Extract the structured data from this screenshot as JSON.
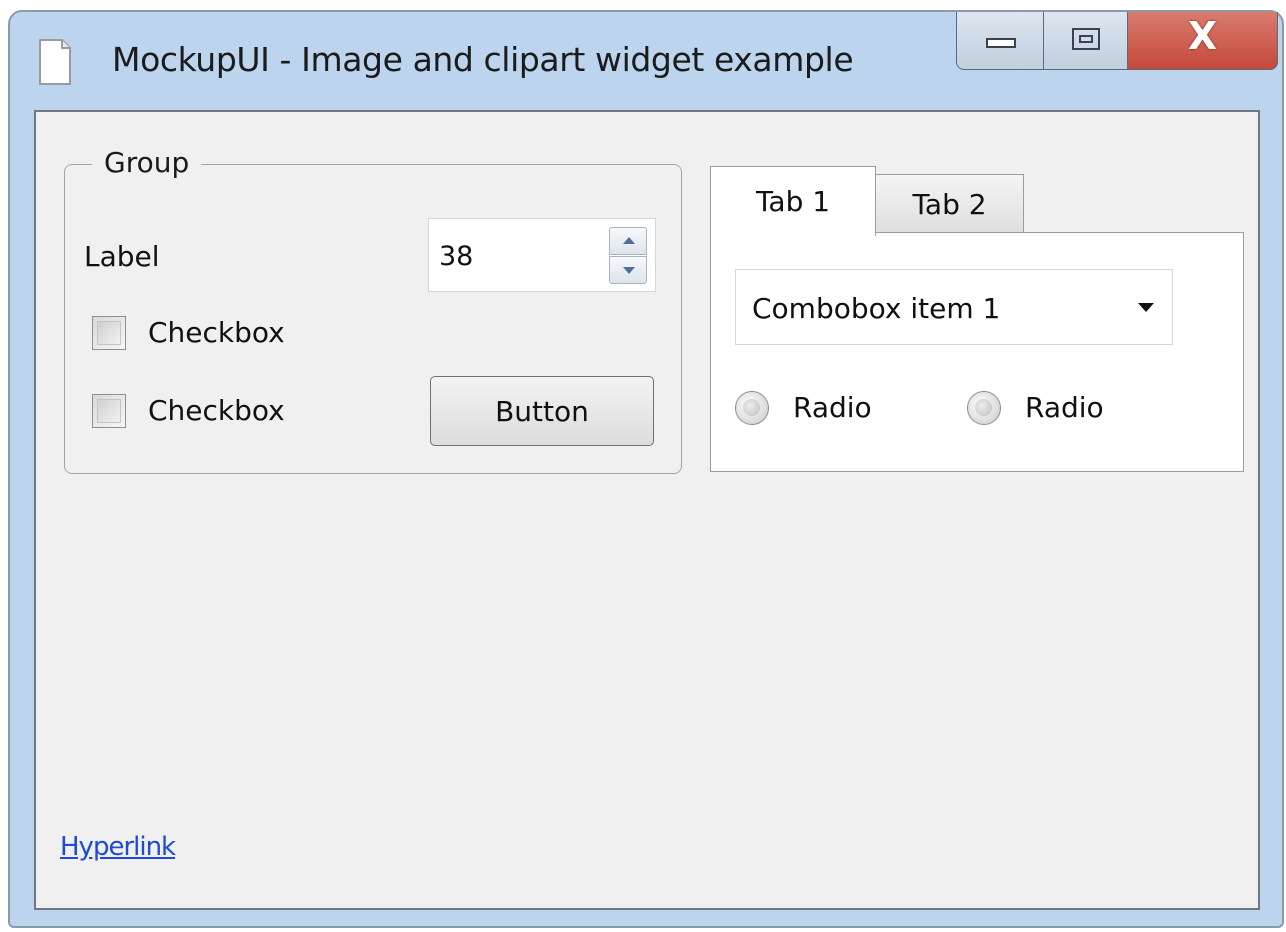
{
  "window": {
    "title": "MockupUI - Image and clipart widget example",
    "controls": {
      "minimize": "",
      "maximize": "",
      "close": "X"
    }
  },
  "group": {
    "legend": "Group",
    "label": "Label",
    "spinner_value": "38",
    "checkboxes": [
      {
        "label": "Checkbox",
        "checked": false
      },
      {
        "label": "Checkbox",
        "checked": false
      }
    ],
    "button_label": "Button"
  },
  "tabs": {
    "items": [
      {
        "label": "Tab 1",
        "active": true
      },
      {
        "label": "Tab 2",
        "active": false
      }
    ],
    "combobox_value": "Combobox item 1",
    "radios": [
      {
        "label": "Radio",
        "selected": false
      },
      {
        "label": "Radio",
        "selected": false
      }
    ]
  },
  "hyperlink_text": "Hyperlink",
  "colors": {
    "titlebar": "#bcd4ee",
    "client_bg": "#f0f0f0",
    "close_button": "#c4493a",
    "link": "#1f4ad8"
  }
}
